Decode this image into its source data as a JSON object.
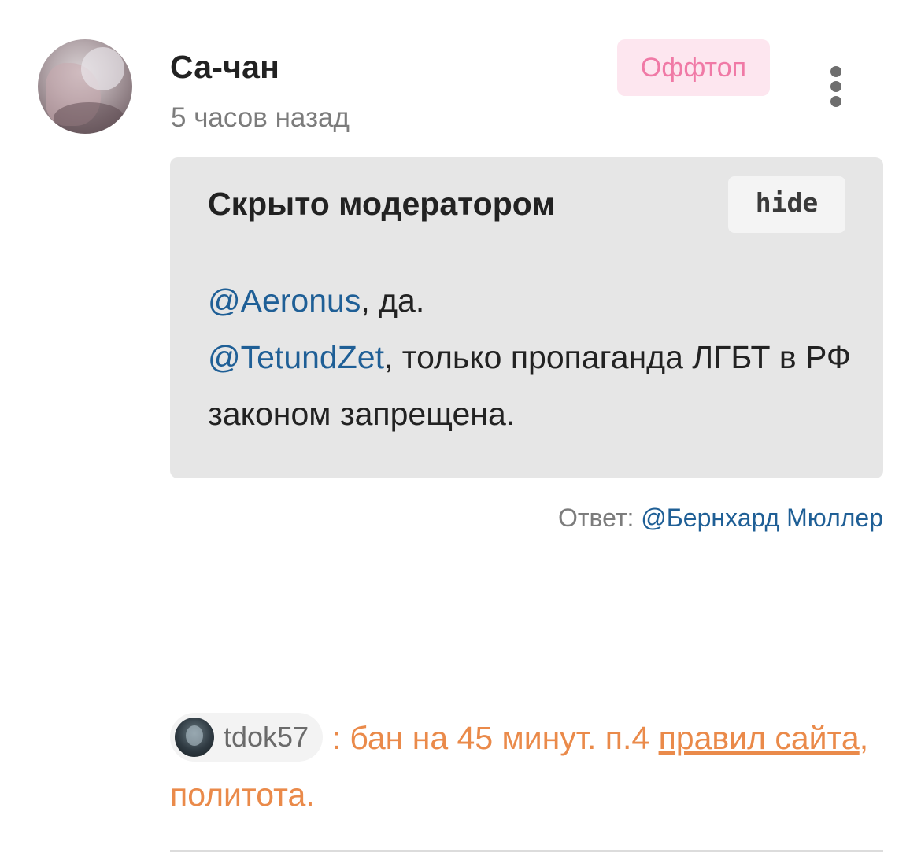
{
  "comment": {
    "author": "Са-чан",
    "timestamp": "5 часов назад",
    "badge": "Оффтоп",
    "hidden_title": "Скрыто модератором",
    "hide_button": "hide",
    "body": {
      "mention1": "@Aeronus",
      "text1": ", да.",
      "mention2": "@TetundZet",
      "text2": ", только пропаганда ЛГБТ в РФ законом запрещена."
    },
    "reply": {
      "label": "Ответ:",
      "mention": "@Бернхард Мюллер"
    }
  },
  "moderation": {
    "moderator": "tdok57",
    "separator": ":",
    "text_before": "бан на 45 минут. п.4",
    "link_text": "правил сайта",
    "text_after": ", политота."
  },
  "colors": {
    "mention": "#1f5f96",
    "moderation_text": "#ea8a4a",
    "badge_text": "#f07aa6",
    "badge_bg": "#fde6ef",
    "hidden_bg": "#e6e6e6"
  },
  "icons": {
    "menu": "more-vertical-icon"
  }
}
